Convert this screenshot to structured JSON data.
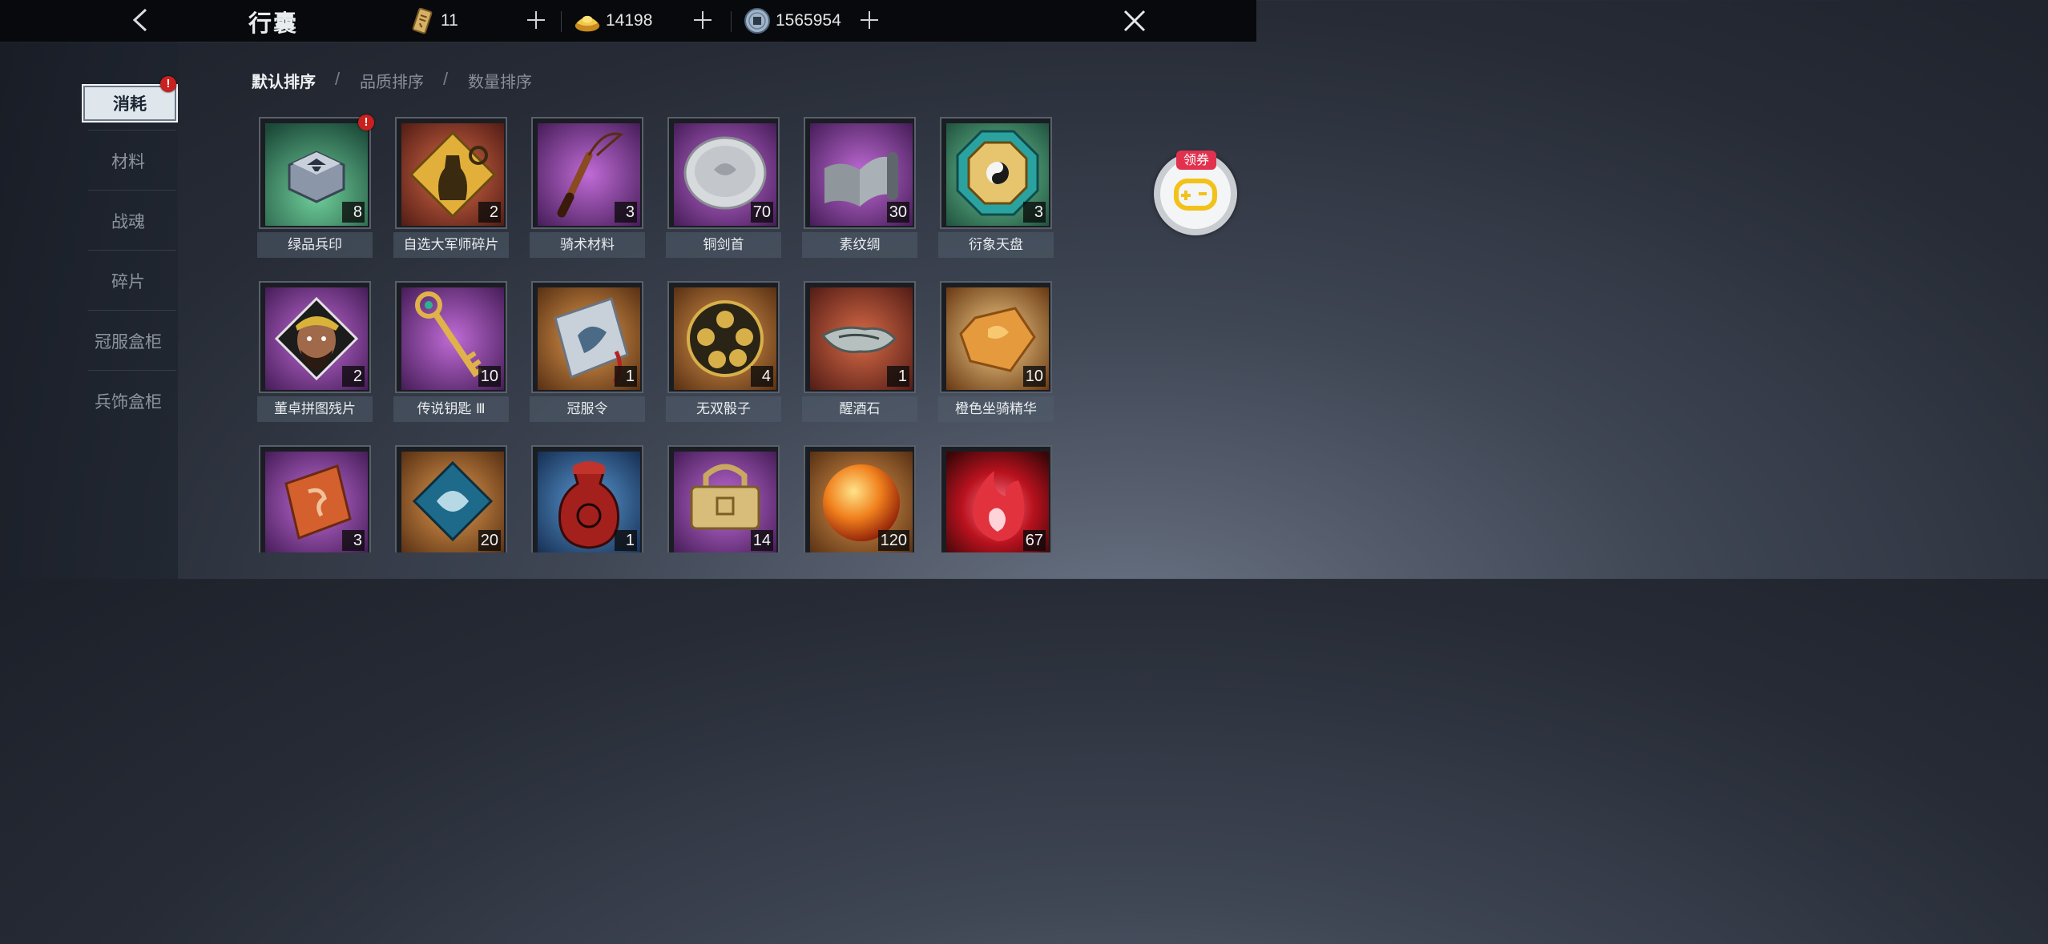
{
  "header": {
    "title": "行囊",
    "resources": [
      {
        "name": "token-icon",
        "value": "11"
      },
      {
        "name": "gold-ingot-icon",
        "value": "14198"
      },
      {
        "name": "coin-icon",
        "value": "1565954"
      }
    ]
  },
  "sidebar": {
    "items": [
      {
        "label": "消耗",
        "active": true,
        "alert": "!"
      },
      {
        "label": "材料"
      },
      {
        "label": "战魂"
      },
      {
        "label": "碎片"
      },
      {
        "label": "冠服盒柜"
      },
      {
        "label": "兵饰盒柜"
      }
    ]
  },
  "sort": {
    "options": [
      "默认排序",
      "品质排序",
      "数量排序"
    ],
    "separator": "/"
  },
  "items": [
    {
      "name": "绿品兵印",
      "count": "8",
      "alert": "!",
      "bg": "#2f8a66",
      "icon": "hex-seal-icon"
    },
    {
      "name": "自选大军师碎片",
      "count": "2",
      "bg": "#b5402e",
      "icon": "strategist-fragment-icon"
    },
    {
      "name": "骑术材料",
      "count": "3",
      "bg": "#8a3aa8",
      "icon": "whip-icon"
    },
    {
      "name": "铜剑首",
      "count": "70",
      "bg": "#8a3aa8",
      "icon": "sword-pommel-icon"
    },
    {
      "name": "素纹绸",
      "count": "30",
      "bg": "#8a3aa8",
      "icon": "silk-scroll-icon"
    },
    {
      "name": "衍象天盘",
      "count": "3",
      "bg": "#2f8a66",
      "icon": "bagua-plate-icon"
    },
    {
      "name": "董卓拼图残片",
      "count": "2",
      "bg": "#8a3aa8",
      "icon": "dongzhuo-portrait-icon"
    },
    {
      "name": "传说钥匙 Ⅲ",
      "count": "10",
      "bg": "#8a3aa8",
      "icon": "key-icon"
    },
    {
      "name": "冠服令",
      "count": "1",
      "bg": "#b5722e",
      "icon": "costume-token-icon"
    },
    {
      "name": "无双骰子",
      "count": "4",
      "bg": "#b5722e",
      "icon": "dice-icon"
    },
    {
      "name": "醒酒石",
      "count": "1",
      "bg": "#b5402e",
      "icon": "sober-stone-icon"
    },
    {
      "name": "橙色坐骑精华",
      "count": "10",
      "bg": "#b5722e",
      "icon": "mount-essence-icon"
    },
    {
      "name": "",
      "count": "3",
      "bg": "#8a3aa8",
      "icon": "wooden-tablet-icon"
    },
    {
      "name": "",
      "count": "20",
      "bg": "#b5722e",
      "icon": "jade-medallion-icon"
    },
    {
      "name": "",
      "count": "1",
      "bg": "#2e6bb5",
      "icon": "wine-jar-icon"
    },
    {
      "name": "",
      "count": "14",
      "bg": "#8a3aa8",
      "icon": "padlock-icon"
    },
    {
      "name": "",
      "count": "120",
      "bg": "#b5722e",
      "icon": "fire-orb-icon"
    },
    {
      "name": "",
      "count": "67",
      "bg": "#b5402e",
      "icon": "red-flame-icon"
    }
  ],
  "coupon": {
    "label": "领券"
  }
}
